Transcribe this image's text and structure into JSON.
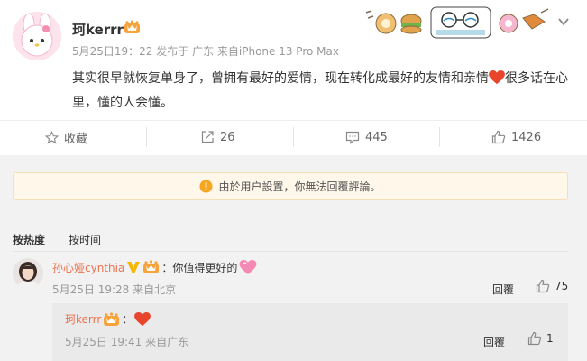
{
  "post": {
    "author": "珂kerrr",
    "meta": "5月25日19：22 发布于 广东 来自iPhone 13 Pro Max",
    "text": "其实很早就恢复单身了，曾拥有最好的爱情，现在转化成最好的友情和亲情",
    "text_after_heart": "很多话在心里，懂的人会懂。",
    "actions": {
      "favorite_label": "收藏",
      "share_count": "26",
      "comment_count": "445",
      "like_count": "1426"
    }
  },
  "notice": {
    "text": "由於用户設置，你無法回覆評論。"
  },
  "comments": {
    "sort_hot": "按热度",
    "sort_time": "按时间",
    "items": [
      {
        "name": "孙心娅cynthia",
        "text": "：你值得更好的",
        "time": "5月25日 19:28 来自北京",
        "reply_label": "回覆",
        "likes": "75",
        "reply": {
          "name": "珂kerrr",
          "text": "：",
          "time": "5月25日 19:41 来自广东",
          "reply_label": "回覆",
          "likes": "1"
        }
      }
    ]
  },
  "colors": {
    "accent": "#eb7350",
    "heart": "#e8452c",
    "notice_bg": "#fff7ea",
    "warning_icon": "#f5a623"
  },
  "icons": {
    "favorite": "star-icon",
    "share": "share-icon",
    "comment": "comment-icon",
    "like": "thumb-up-icon",
    "more": "chevron-down-icon",
    "notice": "warning-icon"
  }
}
